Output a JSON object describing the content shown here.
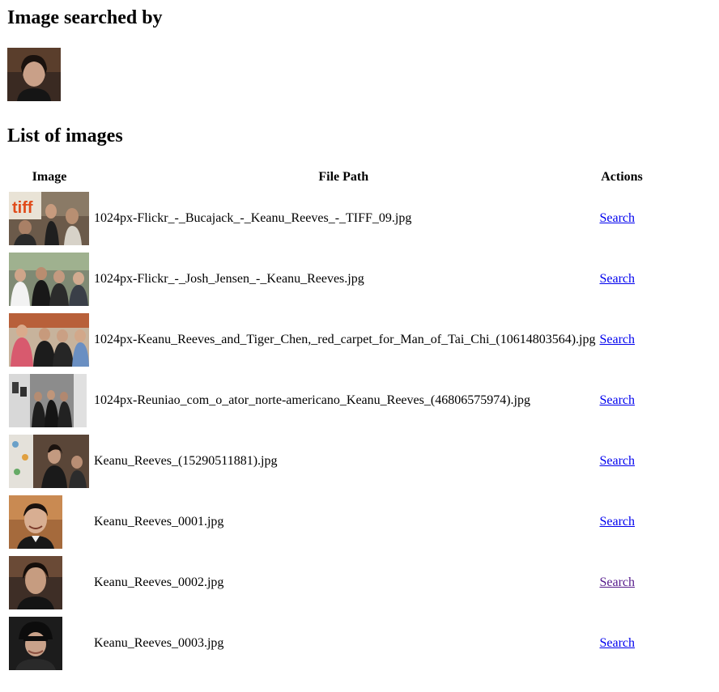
{
  "headings": {
    "searched_by": "Image searched by",
    "list": "List of images"
  },
  "table": {
    "columns": [
      "Image",
      "File Path",
      "Actions"
    ],
    "rows": [
      {
        "path": "1024px-Flickr_-_Bucajack_-_Keanu_Reeves_-_TIFF_09.jpg",
        "action": "Search",
        "visited": false
      },
      {
        "path": "1024px-Flickr_-_Josh_Jensen_-_Keanu_Reeves.jpg",
        "action": "Search",
        "visited": false
      },
      {
        "path": "1024px-Keanu_Reeves_and_Tiger_Chen,_red_carpet_for_Man_of_Tai_Chi_(10614803564).jpg",
        "action": "Search",
        "visited": false
      },
      {
        "path": "1024px-Reuniao_com_o_ator_norte-americano_Keanu_Reeves_(46806575974).jpg",
        "action": "Search",
        "visited": false
      },
      {
        "path": "Keanu_Reeves_(15290511881).jpg",
        "action": "Search",
        "visited": false
      },
      {
        "path": "Keanu_Reeves_0001.jpg",
        "action": "Search",
        "visited": false
      },
      {
        "path": "Keanu_Reeves_0002.jpg",
        "action": "Search",
        "visited": true
      },
      {
        "path": "Keanu_Reeves_0003.jpg",
        "action": "Search",
        "visited": false
      }
    ]
  },
  "colors": {
    "link": "#0000ee",
    "visited_link": "#551a8b"
  }
}
